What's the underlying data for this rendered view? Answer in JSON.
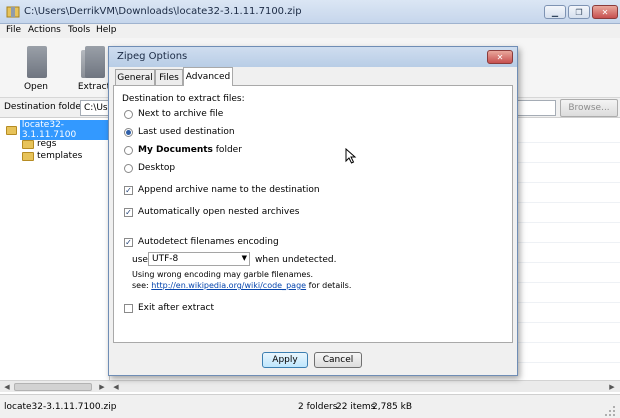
{
  "window": {
    "title": "C:\\Users\\DerrikVM\\Downloads\\locate32-3.1.11.7100.zip",
    "controls": [
      "▁",
      "❐",
      "✕"
    ]
  },
  "menu": [
    "File",
    "Actions",
    "Tools",
    "Help"
  ],
  "toolbar": {
    "open_label": "Open",
    "extract_label": "Extract"
  },
  "destination": {
    "label": "Destination folder:",
    "value": "C:\\Use",
    "browse_label": "Browse..."
  },
  "tree": {
    "root": "locate32-3.1.11.7100",
    "children": [
      "regs",
      "templates"
    ]
  },
  "status": {
    "file": "locate32-3.1.11.7100.zip",
    "folders": "2 folders",
    "items": "22 items",
    "size": "2,785 kB"
  },
  "dialog": {
    "title": "Zipeg Options",
    "close_glyph": "✕",
    "tabs": [
      "General",
      "Files",
      "Advanced"
    ],
    "heading": "Destination to extract files:",
    "radios": [
      {
        "label": "Next to archive file",
        "checked": false
      },
      {
        "label": "Last used destination",
        "checked": true
      },
      {
        "label_bold": "My Documents",
        "label_rest": " folder",
        "checked": false
      },
      {
        "label": "Desktop",
        "checked": false
      }
    ],
    "checks": {
      "append": "Append archive name to the destination",
      "nested": "Automatically open nested archives",
      "autodetect": "Autodetect filenames encoding",
      "exit": "Exit after extract"
    },
    "encoding": {
      "use_label": "use:",
      "value": "UTF-8",
      "suffix": "when undetected.",
      "note": "Using wrong encoding may garble filenames.",
      "see_label": "see:",
      "link": "http://en.wikipedia.org/wiki/code_page",
      "after_link": " for details."
    },
    "apply_label": "Apply",
    "cancel_label": "Cancel"
  }
}
